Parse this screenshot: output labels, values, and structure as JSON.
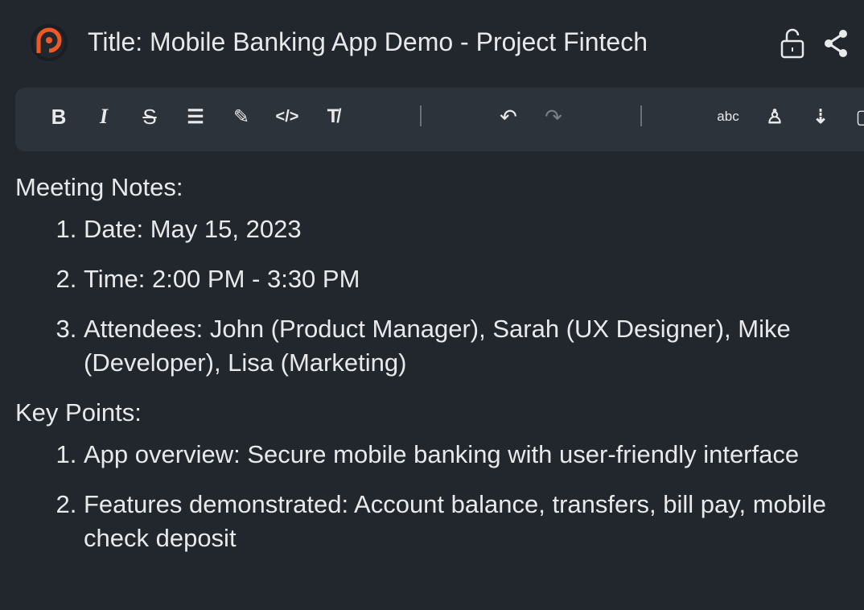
{
  "header": {
    "title": "Title: Mobile Banking App Demo - Project Fintech"
  },
  "toolbar": {
    "bold": "B",
    "italic": "I",
    "undo": "↶",
    "redo": "↷",
    "spellcheck": "abc"
  },
  "content": {
    "section1": "Meeting Notes:",
    "items1": [
      "Date: May 15, 2023",
      "Time: 2:00 PM - 3:30 PM",
      "Attendees: John (Product Manager), Sarah (UX Designer), Mike (Developer), Lisa (Marketing)"
    ],
    "section2": "Key Points:",
    "items2": [
      "App overview: Secure mobile banking with user-friendly interface",
      "Features demonstrated: Account balance, transfers, bill pay, mobile check deposit"
    ]
  },
  "colors": {
    "accent": "#f05a22",
    "background": "#22272e",
    "toolbar": "#2d333b"
  }
}
